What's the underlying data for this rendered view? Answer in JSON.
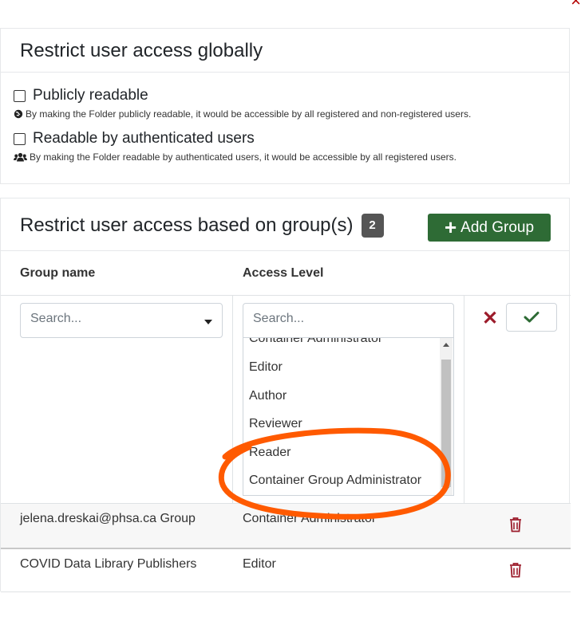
{
  "dialog": {
    "close_icon": "×"
  },
  "global_section": {
    "title": "Restrict user access globally",
    "options": [
      {
        "label": "Publicly readable",
        "checked": false,
        "help_icon": "globe-icon",
        "help": "By making the Folder publicly readable, it would be accessible by all registered and non-registered users."
      },
      {
        "label": "Readable by authenticated users",
        "checked": false,
        "help_icon": "users-icon",
        "help": "By making the Folder readable by authenticated users, it would be accessible by all registered users."
      }
    ]
  },
  "group_section": {
    "title": "Restrict user access based on group(s)",
    "count": "2",
    "add_button": "Add Group",
    "columns": {
      "group_name": "Group name",
      "access_level": "Access Level"
    },
    "new_row": {
      "group_placeholder": "Search...",
      "access_placeholder": "Search...",
      "access_options": [
        "Container Administrator",
        "Editor",
        "Author",
        "Reviewer",
        "Reader",
        "Container Group Administrator"
      ]
    },
    "rows": [
      {
        "group": "jelena.dreskai@phsa.ca Group",
        "access": "Container Administrator"
      },
      {
        "group": "COVID Data Library Publishers",
        "access": "Editor"
      }
    ]
  },
  "colors": {
    "add_button": "#2e6b35",
    "danger": "#9c1c2b",
    "confirm": "#2e6b35",
    "annotation": "#ff5a00"
  }
}
